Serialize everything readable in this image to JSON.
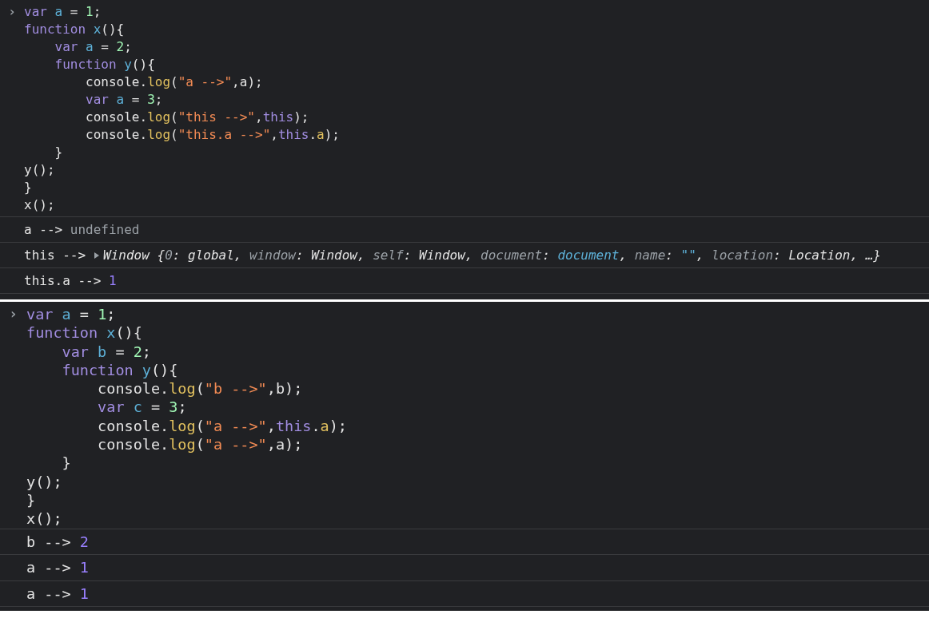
{
  "panels": [
    {
      "prompt": "›",
      "input": [
        {
          "tokens": [
            {
              "text": "var",
              "kind": "keyword"
            },
            {
              "text": " a",
              "kind": "variable"
            },
            {
              "text": " = ",
              "kind": "plain"
            },
            {
              "text": "1",
              "kind": "number"
            },
            {
              "text": ";",
              "kind": "plain"
            }
          ]
        },
        {
          "tokens": [
            {
              "text": "function",
              "kind": "keyword"
            },
            {
              "text": " x",
              "kind": "function"
            },
            {
              "text": "(){",
              "kind": "plain"
            }
          ]
        },
        {
          "tokens": [
            {
              "text": "    var",
              "kind": "keyword"
            },
            {
              "text": " a",
              "kind": "variable"
            },
            {
              "text": " = ",
              "kind": "plain"
            },
            {
              "text": "2",
              "kind": "number"
            },
            {
              "text": ";",
              "kind": "plain"
            }
          ]
        },
        {
          "tokens": [
            {
              "text": "    function",
              "kind": "keyword"
            },
            {
              "text": " y",
              "kind": "function"
            },
            {
              "text": "(){",
              "kind": "plain"
            }
          ]
        },
        {
          "tokens": [
            {
              "text": "        console.",
              "kind": "plain"
            },
            {
              "text": "log",
              "kind": "method"
            },
            {
              "text": "(",
              "kind": "plain"
            },
            {
              "text": "\"a -->\"",
              "kind": "string"
            },
            {
              "text": ",a);",
              "kind": "plain"
            }
          ]
        },
        {
          "tokens": [
            {
              "text": "        var",
              "kind": "keyword"
            },
            {
              "text": " a",
              "kind": "variable"
            },
            {
              "text": " = ",
              "kind": "plain"
            },
            {
              "text": "3",
              "kind": "number"
            },
            {
              "text": ";",
              "kind": "plain"
            }
          ]
        },
        {
          "tokens": [
            {
              "text": "        console.",
              "kind": "plain"
            },
            {
              "text": "log",
              "kind": "method"
            },
            {
              "text": "(",
              "kind": "plain"
            },
            {
              "text": "\"this -->\"",
              "kind": "string"
            },
            {
              "text": ",",
              "kind": "plain"
            },
            {
              "text": "this",
              "kind": "this"
            },
            {
              "text": ");",
              "kind": "plain"
            }
          ]
        },
        {
          "tokens": [
            {
              "text": "        console.",
              "kind": "plain"
            },
            {
              "text": "log",
              "kind": "method"
            },
            {
              "text": "(",
              "kind": "plain"
            },
            {
              "text": "\"this.a -->\"",
              "kind": "string"
            },
            {
              "text": ",",
              "kind": "plain"
            },
            {
              "text": "this",
              "kind": "this"
            },
            {
              "text": ".",
              "kind": "plain"
            },
            {
              "text": "a",
              "kind": "property"
            },
            {
              "text": ");",
              "kind": "plain"
            }
          ]
        },
        {
          "tokens": [
            {
              "text": "    }",
              "kind": "plain"
            }
          ]
        },
        {
          "tokens": [
            {
              "text": "y();",
              "kind": "plain"
            }
          ]
        },
        {
          "tokens": [
            {
              "text": "}",
              "kind": "plain"
            }
          ]
        },
        {
          "tokens": [
            {
              "text": "x();",
              "kind": "plain"
            }
          ]
        }
      ],
      "outputs": [
        {
          "tokens": [
            {
              "text": "a -->",
              "kind": "plain"
            },
            {
              "text": " undefined",
              "kind": "undefined"
            }
          ]
        },
        {
          "tokens": [
            {
              "text": "this -->",
              "kind": "plain"
            }
          ],
          "object": {
            "expanded": false,
            "tokens": [
              {
                "text": "Window {",
                "kind": "plain"
              },
              {
                "text": "0",
                "kind": "key"
              },
              {
                "text": ": global, ",
                "kind": "plain"
              },
              {
                "text": "window",
                "kind": "key"
              },
              {
                "text": ": Window, ",
                "kind": "plain"
              },
              {
                "text": "self",
                "kind": "key"
              },
              {
                "text": ": Window, ",
                "kind": "plain"
              },
              {
                "text": "document",
                "kind": "key"
              },
              {
                "text": ": ",
                "kind": "plain"
              },
              {
                "text": "document",
                "kind": "link"
              },
              {
                "text": ", ",
                "kind": "plain"
              },
              {
                "text": "name",
                "kind": "key"
              },
              {
                "text": ": ",
                "kind": "plain"
              },
              {
                "text": "\"\"",
                "kind": "link"
              },
              {
                "text": ", ",
                "kind": "plain"
              },
              {
                "text": "location",
                "kind": "key"
              },
              {
                "text": ": Location, …}",
                "kind": "plain"
              }
            ]
          }
        },
        {
          "tokens": [
            {
              "text": "this.a -->",
              "kind": "plain"
            },
            {
              "text": " 1",
              "kind": "result"
            }
          ]
        }
      ]
    },
    {
      "prompt": "›",
      "input": [
        {
          "tokens": [
            {
              "text": "var",
              "kind": "keyword"
            },
            {
              "text": " a",
              "kind": "variable"
            },
            {
              "text": " = ",
              "kind": "plain"
            },
            {
              "text": "1",
              "kind": "number"
            },
            {
              "text": ";",
              "kind": "plain"
            }
          ]
        },
        {
          "tokens": [
            {
              "text": "function",
              "kind": "keyword"
            },
            {
              "text": " x",
              "kind": "function"
            },
            {
              "text": "(){",
              "kind": "plain"
            }
          ]
        },
        {
          "tokens": [
            {
              "text": "    var",
              "kind": "keyword"
            },
            {
              "text": " b",
              "kind": "variable"
            },
            {
              "text": " = ",
              "kind": "plain"
            },
            {
              "text": "2",
              "kind": "number"
            },
            {
              "text": ";",
              "kind": "plain"
            }
          ]
        },
        {
          "tokens": [
            {
              "text": "    function",
              "kind": "keyword"
            },
            {
              "text": " y",
              "kind": "function"
            },
            {
              "text": "(){",
              "kind": "plain"
            }
          ]
        },
        {
          "tokens": [
            {
              "text": "        console.",
              "kind": "plain"
            },
            {
              "text": "log",
              "kind": "method"
            },
            {
              "text": "(",
              "kind": "plain"
            },
            {
              "text": "\"b -->\"",
              "kind": "string"
            },
            {
              "text": ",b);",
              "kind": "plain"
            }
          ]
        },
        {
          "tokens": [
            {
              "text": "        var",
              "kind": "keyword"
            },
            {
              "text": " c",
              "kind": "variable"
            },
            {
              "text": " = ",
              "kind": "plain"
            },
            {
              "text": "3",
              "kind": "number"
            },
            {
              "text": ";",
              "kind": "plain"
            }
          ]
        },
        {
          "tokens": [
            {
              "text": "        console.",
              "kind": "plain"
            },
            {
              "text": "log",
              "kind": "method"
            },
            {
              "text": "(",
              "kind": "plain"
            },
            {
              "text": "\"a -->\"",
              "kind": "string"
            },
            {
              "text": ",",
              "kind": "plain"
            },
            {
              "text": "this",
              "kind": "this"
            },
            {
              "text": ".",
              "kind": "plain"
            },
            {
              "text": "a",
              "kind": "property"
            },
            {
              "text": ");",
              "kind": "plain"
            }
          ]
        },
        {
          "tokens": [
            {
              "text": "        console.",
              "kind": "plain"
            },
            {
              "text": "log",
              "kind": "method"
            },
            {
              "text": "(",
              "kind": "plain"
            },
            {
              "text": "\"a -->\"",
              "kind": "string"
            },
            {
              "text": ",a);",
              "kind": "plain"
            }
          ]
        },
        {
          "tokens": [
            {
              "text": "    }",
              "kind": "plain"
            }
          ]
        },
        {
          "tokens": [
            {
              "text": "y();",
              "kind": "plain"
            }
          ]
        },
        {
          "tokens": [
            {
              "text": "}",
              "kind": "plain"
            }
          ]
        },
        {
          "tokens": [
            {
              "text": "x();",
              "kind": "plain"
            }
          ]
        }
      ],
      "outputs": [
        {
          "tokens": [
            {
              "text": "b -->",
              "kind": "plain"
            },
            {
              "text": " 2",
              "kind": "result"
            }
          ]
        },
        {
          "tokens": [
            {
              "text": "a -->",
              "kind": "plain"
            },
            {
              "text": " 1",
              "kind": "result"
            }
          ]
        },
        {
          "tokens": [
            {
              "text": "a -->",
              "kind": "plain"
            },
            {
              "text": " 1",
              "kind": "result"
            }
          ]
        }
      ]
    }
  ]
}
